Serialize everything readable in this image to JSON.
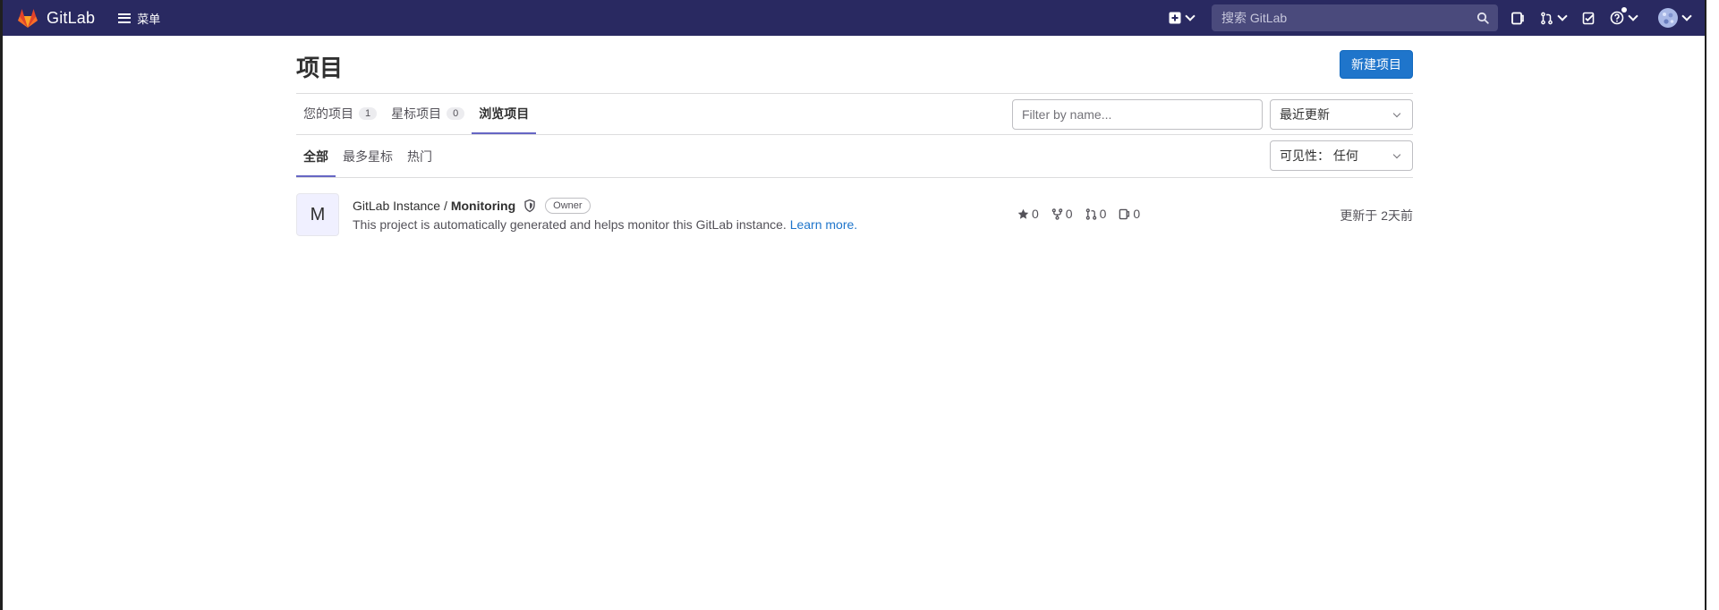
{
  "navbar": {
    "brand_name": "GitLab",
    "menu_label": "菜单",
    "search_placeholder": "搜索 GitLab",
    "brand_color": "#292961"
  },
  "page": {
    "title": "项目",
    "new_project_label": "新建项目"
  },
  "tabs": [
    {
      "label": "您的项目",
      "count": "1"
    },
    {
      "label": "星标项目",
      "count": "0"
    },
    {
      "label": "浏览项目",
      "active": true
    }
  ],
  "filter": {
    "placeholder": "Filter by name...",
    "sort_value": "最近更新",
    "visibility_value": "可见性： 任何"
  },
  "subtabs": [
    {
      "label": "全部",
      "active": true
    },
    {
      "label": "最多星标"
    },
    {
      "label": "热门"
    }
  ],
  "project": {
    "avatar_letter": "M",
    "namespace": "GitLab Instance /",
    "name": "Monitoring",
    "role": "Owner",
    "description": "This project is automatically generated and helps monitor this GitLab instance.",
    "learn_more": "Learn more.",
    "stars": "0",
    "forks": "0",
    "merge_requests": "0",
    "issues": "0",
    "updated": "更新于 2天前"
  },
  "icons": {
    "logo": "gitlab-tanuki-icon",
    "menu": "hamburger-icon",
    "create": "plus-square-icon",
    "search": "search-icon",
    "issues": "issues-icon",
    "merge_requests": "merge-request-icon",
    "todos": "todo-icon",
    "help": "question-icon",
    "user": "avatar-icon",
    "security": "shield-icon",
    "star": "star-icon",
    "fork": "fork-icon"
  }
}
